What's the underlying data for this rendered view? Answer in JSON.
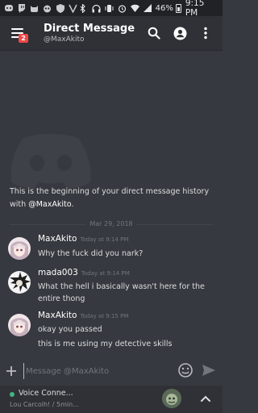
{
  "status_bar": {
    "battery": "46%",
    "time": "9:15 PM"
  },
  "header": {
    "title": "Direct Message",
    "subtitle": "@MaxAkito",
    "badge_count": "2"
  },
  "intro": {
    "text": "This is the beginning of your direct message history with ",
    "user": "@MaxAkito",
    "end": "."
  },
  "date_divider": "Mar 29, 2018",
  "messages": [
    {
      "author": "MaxAkito",
      "timestamp": "Today at 9:14 PM",
      "lines": [
        "Why the fuck did you nark?"
      ]
    },
    {
      "author": "mada003",
      "timestamp": "Today at 9:14 PM",
      "lines": [
        "What the hell i basically wasn't here for the entire thong"
      ]
    },
    {
      "author": "MaxAkito",
      "timestamp": "Today at 9:15 PM",
      "lines": [
        "okay you passed",
        "this is me using my detective skills"
      ]
    }
  ],
  "composer": {
    "placeholder": "Message @MaxAkito"
  },
  "voice": {
    "title": "Voice Conne...",
    "subtitle": "Lou Carcolh! / 5min..."
  },
  "colors": {
    "background": "#36393f",
    "header": "#2f3136",
    "accent_green": "#43b581",
    "badge_red": "#f04747"
  }
}
